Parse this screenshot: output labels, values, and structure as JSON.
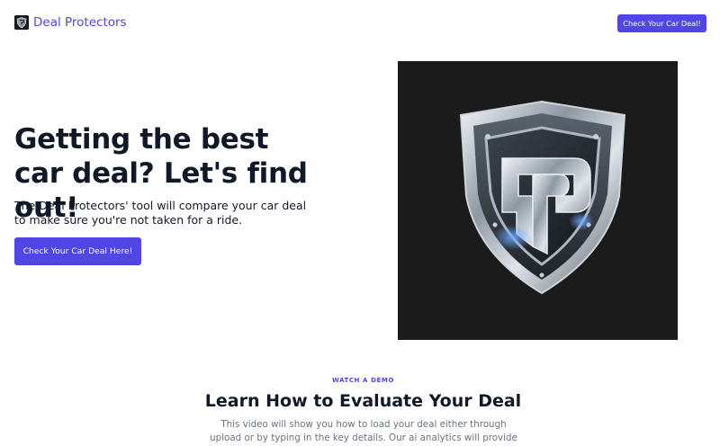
{
  "nav": {
    "logo_icon": "shield-logo-icon",
    "brand": "Deal Protectors",
    "cta_label": "Check Your Car Deal!"
  },
  "hero": {
    "title": "Getting the best car deal? Let's find out!",
    "subtitle": "The Deal Protectors' tool will compare your car deal to make sure you're not taken for a ride.",
    "cta_label": "Check Your Car Deal Here!",
    "image_icon": "chrome-shield-dp-logo"
  },
  "demo": {
    "eyebrow": "WATCH A DEMO",
    "title": "Learn How to Evaluate Your Deal",
    "description": "This video will show you how to load your deal either through upload or by typing in the key details. Our ai analytics will provide you with details and a"
  },
  "colors": {
    "accent": "#4f46e5",
    "heading": "#111827",
    "muted": "#6b7280",
    "image_bg": "#1b1b1b"
  }
}
